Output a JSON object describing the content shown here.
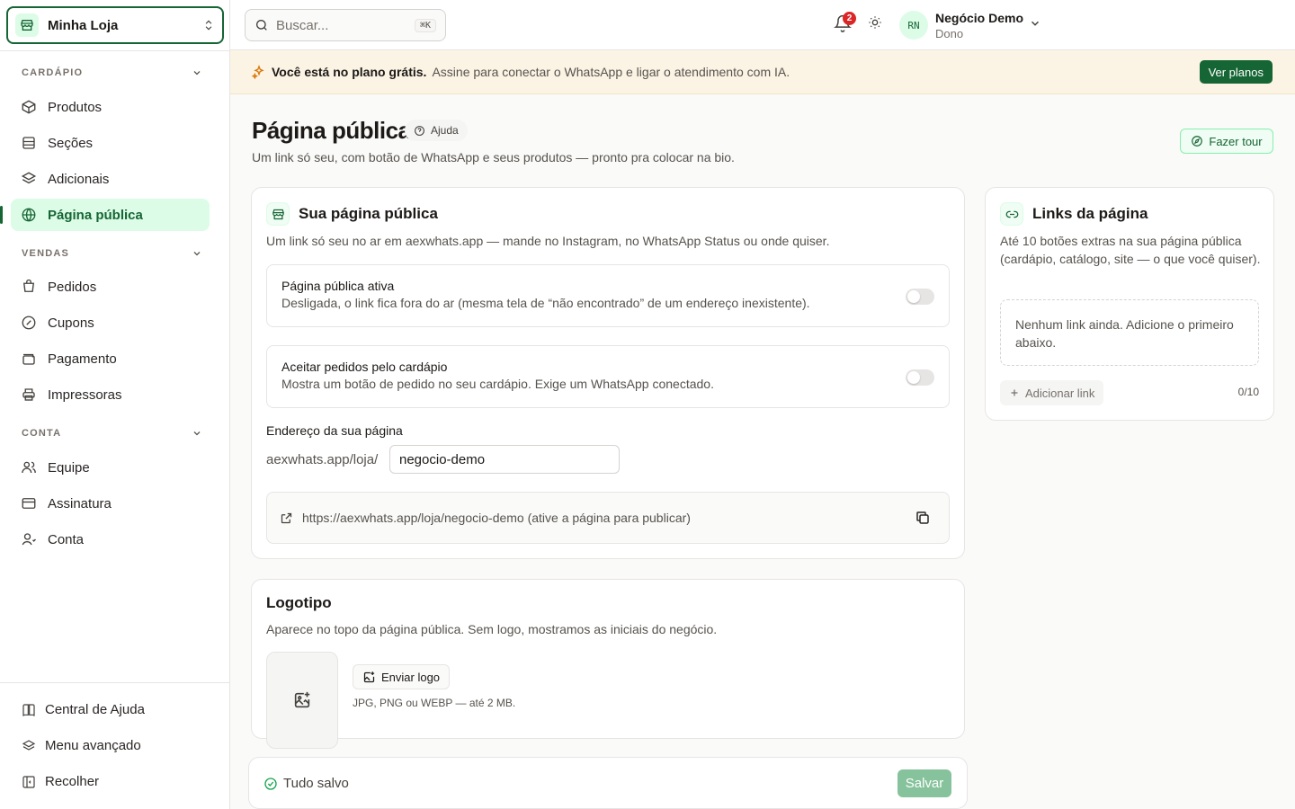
{
  "sidebar": {
    "store_name": "Minha Loja",
    "sections": [
      {
        "title": "CARDÁPIO",
        "items": [
          {
            "label": "Produtos",
            "icon": "box-icon"
          },
          {
            "label": "Seções",
            "icon": "list-icon"
          },
          {
            "label": "Adicionais",
            "icon": "layers-icon"
          },
          {
            "label": "Página pública",
            "icon": "globe-icon",
            "active": true
          }
        ]
      },
      {
        "title": "VENDAS",
        "items": [
          {
            "label": "Pedidos",
            "icon": "cart-icon"
          },
          {
            "label": "Cupons",
            "icon": "coupon-icon"
          },
          {
            "label": "Pagamento",
            "icon": "wallet-icon"
          },
          {
            "label": "Impressoras",
            "icon": "printer-icon"
          }
        ]
      },
      {
        "title": "CONTA",
        "items": [
          {
            "label": "Equipe",
            "icon": "users-icon"
          },
          {
            "label": "Assinatura",
            "icon": "credit-card-icon"
          },
          {
            "label": "Conta",
            "icon": "user-icon"
          }
        ]
      }
    ],
    "bottom": [
      {
        "label": "Central de Ajuda",
        "icon": "book-icon"
      },
      {
        "label": "Menu avançado",
        "icon": "layers-icon"
      },
      {
        "label": "Recolher",
        "icon": "collapse-icon"
      }
    ]
  },
  "topbar": {
    "search_placeholder": "Buscar...",
    "search_shortcut": "⌘K",
    "notification_count": "2",
    "avatar_initials": "RN",
    "user_name": "Negócio Demo",
    "user_role": "Dono"
  },
  "banner": {
    "bold": "Você está no plano grátis.",
    "text": "Assine para conectar o WhatsApp e ligar o atendimento com IA.",
    "button": "Ver planos"
  },
  "page": {
    "title": "Página pública",
    "help": "Ajuda",
    "subtitle": "Um link só seu, com botão de WhatsApp e seus produtos — pronto pra colocar na bio.",
    "tour_button": "Fazer tour"
  },
  "public_card": {
    "title": "Sua página pública",
    "desc": "Um link só seu no ar em aexwhats.app — mande no Instagram, no WhatsApp Status ou onde quiser.",
    "toggle_active_title": "Página pública ativa",
    "toggle_active_desc": "Desligada, o link fica fora do ar (mesma tela de “não encontrado” de um endereço inexistente).",
    "toggle_active_on": false,
    "toggle_orders_title": "Aceitar pedidos pelo cardápio",
    "toggle_orders_desc": "Mostra um botão de pedido no seu cardápio. Exige um WhatsApp conectado.",
    "toggle_orders_on": false,
    "address_label": "Endereço da sua página",
    "address_prefix": "aexwhats.app/loja/",
    "address_value": "negocio-demo",
    "url_text": "https://aexwhats.app/loja/negocio-demo (ative a página para publicar)"
  },
  "logo_card": {
    "title": "Logotipo",
    "desc": "Aparece no topo da página pública. Sem logo, mostramos as iniciais do negócio.",
    "upload_button": "Enviar logo",
    "hint": "JPG, PNG ou WEBP — até 2 MB."
  },
  "links_card": {
    "title": "Links da página",
    "desc": "Até 10 botões extras na sua página pública (cardápio, catálogo, site — o que você quiser).",
    "empty": "Nenhum link ainda. Adicione o primeiro abaixo.",
    "add_button": "Adicionar link",
    "count": "0/10"
  },
  "savebar": {
    "status": "Tudo salvo",
    "save_button": "Salvar"
  },
  "colors": {
    "accent": "#166534",
    "accent_light": "#dcfce7",
    "banner_bg": "#fbf3e4"
  }
}
